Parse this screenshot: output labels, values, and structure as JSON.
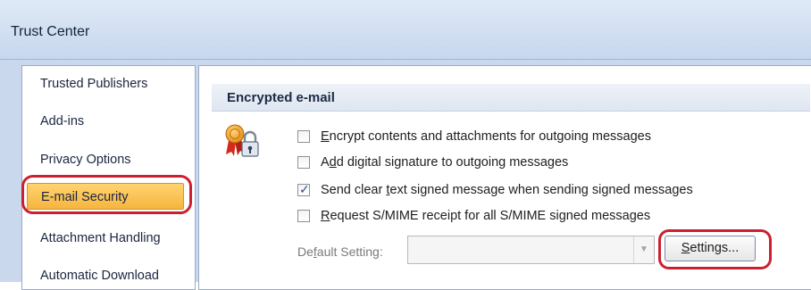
{
  "window": {
    "title": "Trust Center"
  },
  "sidebar": {
    "items": [
      {
        "label": "Trusted Publishers"
      },
      {
        "label": "Add-ins"
      },
      {
        "label": "Privacy Options"
      },
      {
        "label": "E-mail Security",
        "selected": true
      },
      {
        "label": "Attachment Handling"
      },
      {
        "label": "Automatic Download"
      }
    ]
  },
  "encrypted": {
    "header": "Encrypted e-mail",
    "icon": "certificate-lock-icon",
    "options": [
      {
        "key": "E",
        "rest": "ncrypt contents and attachments for outgoing messages",
        "checked": false
      },
      {
        "pre": "A",
        "key": "d",
        "rest": "d digital signature to outgoing messages",
        "checked": false
      },
      {
        "pre": "Send clear ",
        "key": "t",
        "rest": "ext signed message when sending signed messages",
        "checked": true
      },
      {
        "key": "R",
        "rest": "equest S/MIME receipt for all S/MIME signed messages",
        "checked": false
      }
    ],
    "default_setting": {
      "pre": "De",
      "key": "f",
      "rest": "ault Setting:",
      "value": ""
    },
    "settings_button": {
      "key": "S",
      "rest": "ettings..."
    }
  },
  "colors": {
    "selection": "#f6b53f",
    "highlight_outline": "#cc2030",
    "header_bg": "#c7d7ee"
  }
}
